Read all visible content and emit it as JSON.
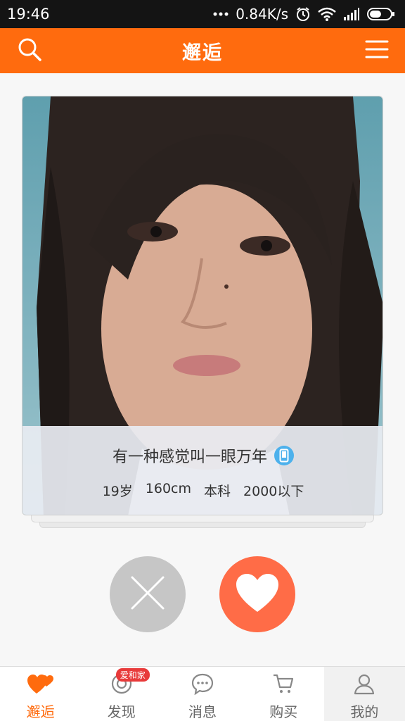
{
  "status_bar": {
    "time": "19:46",
    "network_speed": "0.84K/s",
    "icons": [
      "more-dots-icon",
      "alarm-icon",
      "wifi-icon",
      "signal-icon",
      "battery-icon"
    ]
  },
  "header": {
    "title": "邂逅",
    "left_icon": "search-icon",
    "right_icon": "menu-icon",
    "background": "#ff6b0e"
  },
  "card": {
    "name": "有一种感觉叫一眼万年",
    "verified_icon": "phone-verified-icon",
    "age": "19岁",
    "height": "160cm",
    "education": "本科",
    "income": "2000以下"
  },
  "actions": {
    "dislike_icon": "close-icon",
    "like_icon": "heart-icon",
    "dislike_color": "#c6c6c6",
    "like_color": "#ff6c47"
  },
  "bottom_nav": {
    "items": [
      {
        "label": "邂逅",
        "icon": "hearts-icon",
        "active": true
      },
      {
        "label": "发现",
        "icon": "discover-icon",
        "badge": "爱和家"
      },
      {
        "label": "消息",
        "icon": "chat-icon"
      },
      {
        "label": "购买",
        "icon": "cart-icon"
      },
      {
        "label": "我的",
        "icon": "user-icon"
      }
    ]
  }
}
